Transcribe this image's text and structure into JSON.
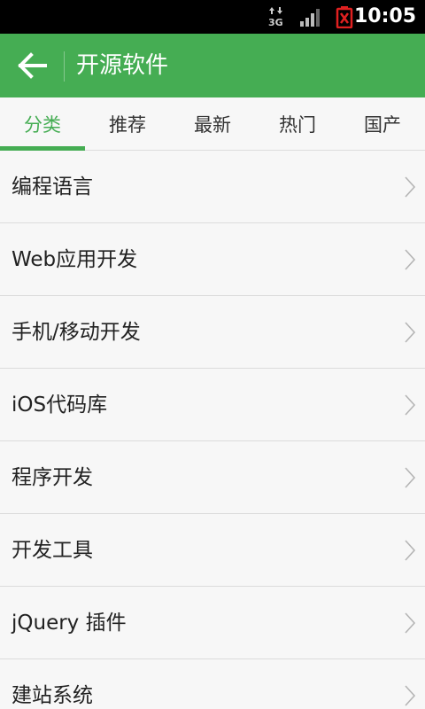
{
  "status_bar": {
    "network_label": "3G",
    "network_icon": "data-3g-icon",
    "signal_icon": "signal-strength-icon",
    "battery_icon": "battery-alert-icon",
    "time": "10:05"
  },
  "action_bar": {
    "back_icon": "arrow-left-icon",
    "title": "开源软件",
    "background_color": "#45ad53"
  },
  "tabs": [
    {
      "label": "分类",
      "active": true
    },
    {
      "label": "推荐",
      "active": false
    },
    {
      "label": "最新",
      "active": false
    },
    {
      "label": "热门",
      "active": false
    },
    {
      "label": "国产",
      "active": false
    }
  ],
  "categories": [
    {
      "label": "编程语言"
    },
    {
      "label": "Web应用开发"
    },
    {
      "label": "手机/移动开发"
    },
    {
      "label": "iOS代码库"
    },
    {
      "label": "程序开发"
    },
    {
      "label": "开发工具"
    },
    {
      "label": "jQuery 插件"
    },
    {
      "label": "建站系统"
    }
  ],
  "colors": {
    "accent": "#45ad53",
    "list_background": "#f7f7f7",
    "divider": "#dcdcdc"
  }
}
